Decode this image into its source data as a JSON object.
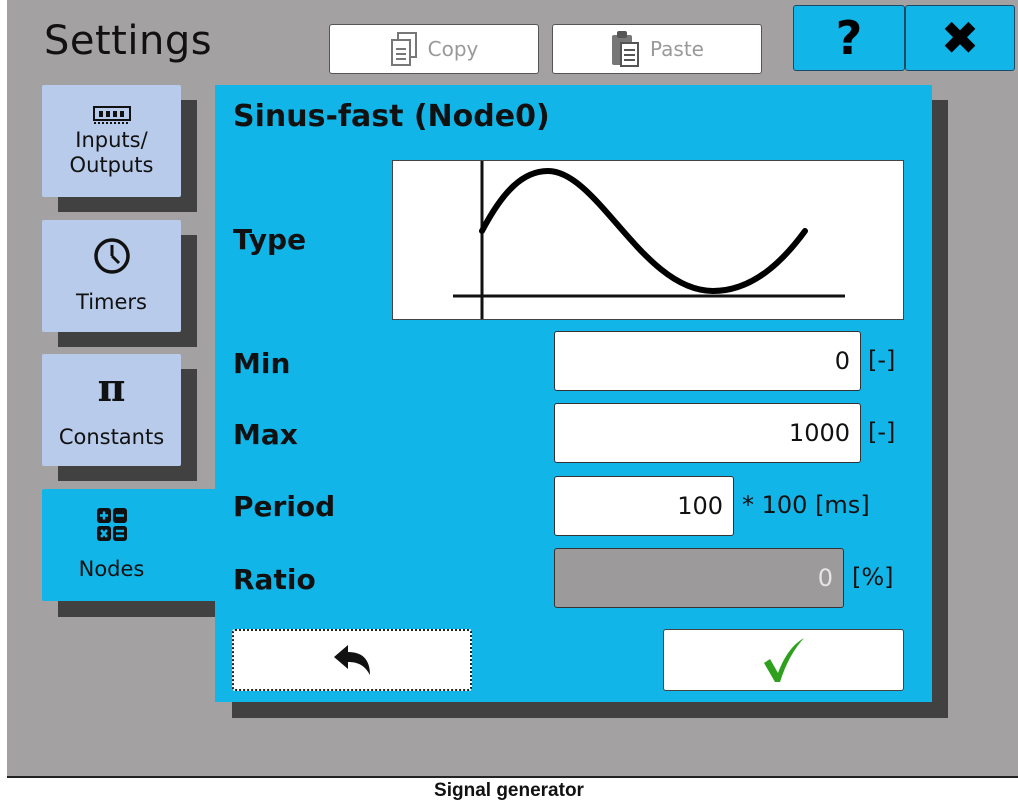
{
  "header": {
    "title": "Settings",
    "copy_label": "Copy",
    "paste_label": "Paste",
    "help_label": "?",
    "close_label": "✖"
  },
  "nav": {
    "items": [
      {
        "label": "Inputs/\nOutputs",
        "icon": "memory-icon",
        "active": false
      },
      {
        "label": "Timers",
        "icon": "clock-icon",
        "active": false
      },
      {
        "label": "Constants",
        "icon": "pi-icon",
        "active": false
      },
      {
        "label": "Nodes",
        "icon": "grid-math-icon",
        "active": true
      }
    ]
  },
  "panel": {
    "title": "Sinus-fast (Node0)",
    "type_label": "Type",
    "min_label": "Min",
    "min_value": "0",
    "min_unit": "[-]",
    "max_label": "Max",
    "max_value": "1000",
    "max_unit": "[-]",
    "period_label": "Period",
    "period_value": "100",
    "period_unit": "* 100 [ms]",
    "ratio_label": "Ratio",
    "ratio_value": "0",
    "ratio_unit": "[%]"
  },
  "caption": "Signal generator",
  "colors": {
    "accent": "#12b5e8",
    "nav_inactive": "#b8cbea",
    "background": "#a4a1a2",
    "confirm": "#2ea01e"
  }
}
